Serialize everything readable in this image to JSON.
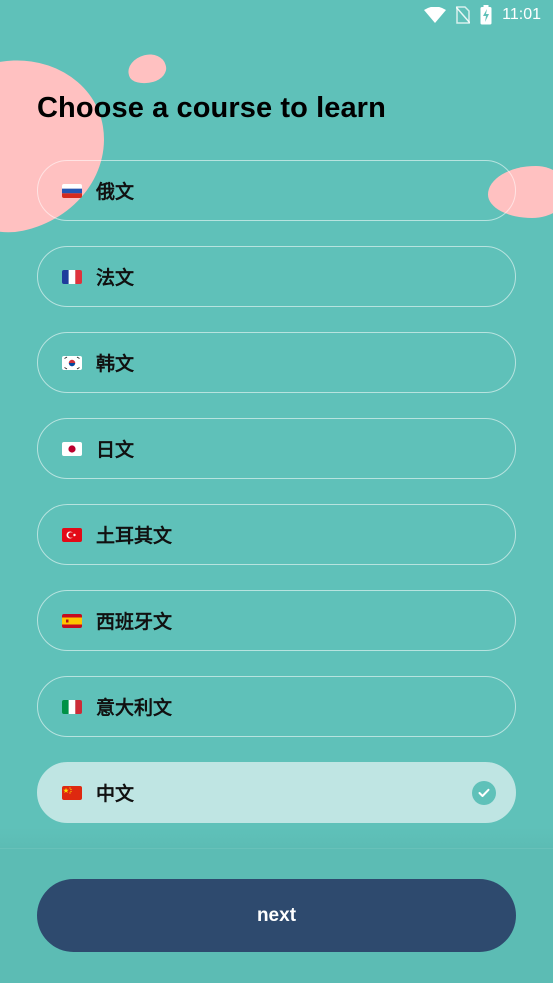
{
  "status_bar": {
    "time": "11:01",
    "icons": [
      "wifi-icon",
      "no-sim-icon",
      "battery-charging-icon"
    ]
  },
  "title": "Choose a course to learn",
  "courses": [
    {
      "label": "俄文",
      "flag": "russia-flag-icon",
      "selected": false
    },
    {
      "label": "法文",
      "flag": "france-flag-icon",
      "selected": false
    },
    {
      "label": "韩文",
      "flag": "south-korea-flag-icon",
      "selected": false
    },
    {
      "label": "日文",
      "flag": "japan-flag-icon",
      "selected": false
    },
    {
      "label": "土耳其文",
      "flag": "turkey-flag-icon",
      "selected": false
    },
    {
      "label": "西班牙文",
      "flag": "spain-flag-icon",
      "selected": false
    },
    {
      "label": "意大利文",
      "flag": "italy-flag-icon",
      "selected": false
    },
    {
      "label": "中文",
      "flag": "china-flag-icon",
      "selected": true
    }
  ],
  "next_button": {
    "label": "next"
  },
  "colors": {
    "background": "#5fc1b9",
    "accent_blob": "#ffc1c1",
    "selected_row": "#bfe5e3",
    "button": "#2e4a6e"
  }
}
